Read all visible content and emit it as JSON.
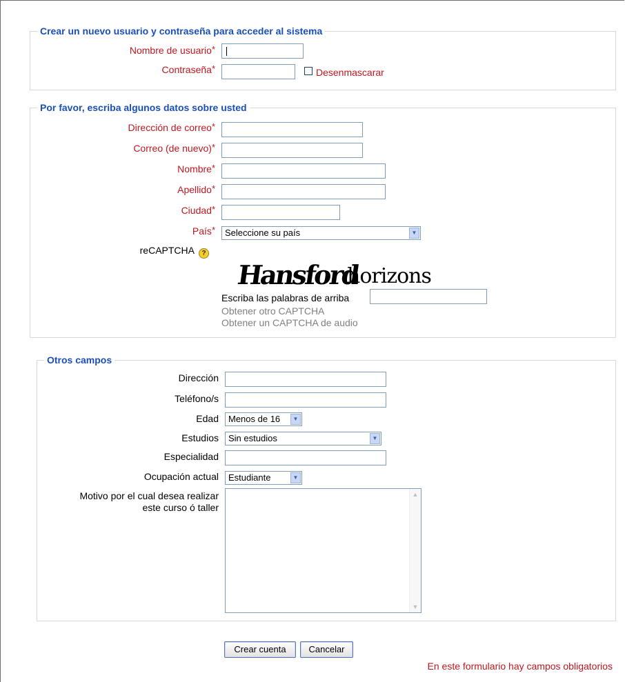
{
  "section_account": {
    "legend": "Crear un nuevo usuario y contraseña para acceder al sistema",
    "username_label": "Nombre de usuario",
    "password_label": "Contraseña",
    "unmask_label": "Desenmascarar"
  },
  "section_personal": {
    "legend": "Por favor, escriba algunos datos sobre usted",
    "email_label": "Dirección de correo",
    "email_again_label": "Correo (de nuevo)",
    "firstname_label": "Nombre",
    "lastname_label": "Apellido",
    "city_label": "Ciudad",
    "country_label": "País",
    "country_value": "Seleccione su país",
    "recaptcha_label": "reCAPTCHA",
    "recaptcha_help_icon": "?",
    "captcha_word1": "Hansford",
    "captcha_word2": "horizons",
    "captcha_prompt": "Escriba las palabras de arriba",
    "captcha_new": "Obtener otro CAPTCHA",
    "captcha_audio": "Obtener un CAPTCHA de audio"
  },
  "section_other": {
    "legend": "Otros campos",
    "address_label": "Dirección",
    "phone_label": "Teléfono/s",
    "age_label": "Edad",
    "age_value": "Menos de 16",
    "studies_label": "Estudios",
    "studies_value": "Sin estudios",
    "specialty_label": "Especialidad",
    "occupation_label": "Ocupación actual",
    "occupation_value": "Estudiante",
    "reason_label_line1": "Motivo por el cual desea realizar",
    "reason_label_line2": "este curso ó taller"
  },
  "required_star": "*",
  "buttons": {
    "create": "Crear cuenta",
    "cancel": "Cancelar"
  },
  "required_note": "En este formulario hay campos obligatorios",
  "colors": {
    "legend": "#1b4fb8",
    "required": "#c0171f",
    "link_gray": "#808080"
  }
}
